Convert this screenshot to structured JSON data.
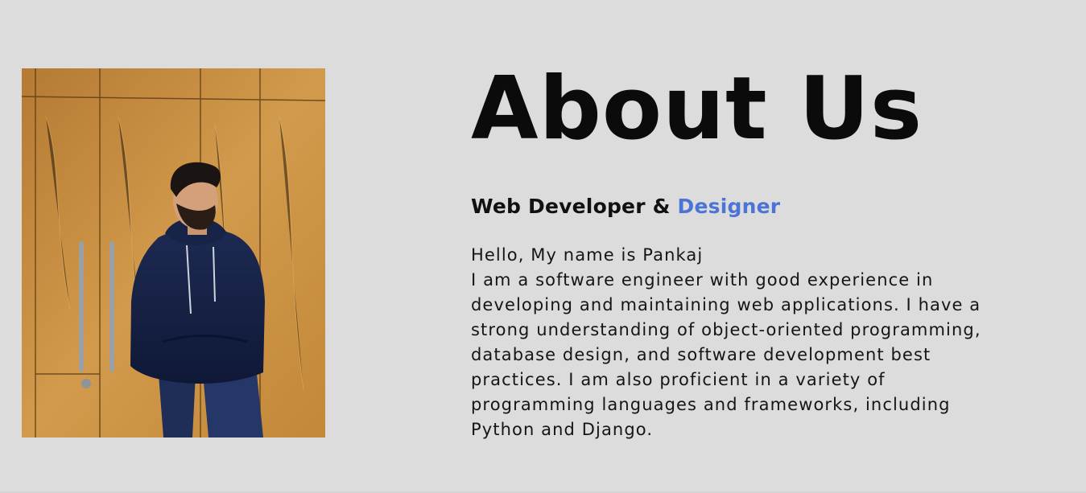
{
  "about": {
    "title": "About Us",
    "subtitle_main": "Web Developer & ",
    "subtitle_accent": "Designer",
    "greeting": "Hello, My name is Pankaj",
    "bio": "I am a software engineer with good experience in developing and maintaining web applications. I have a strong understanding of object-oriented programming, database design, and software development best practices. I am also proficient in a variety of programming languages and frameworks, including Python and Django."
  },
  "colors": {
    "background": "#dcdcdc",
    "accent": "#4a74d6",
    "text": "#111111"
  },
  "photo": {
    "subject": "profile-photo"
  }
}
